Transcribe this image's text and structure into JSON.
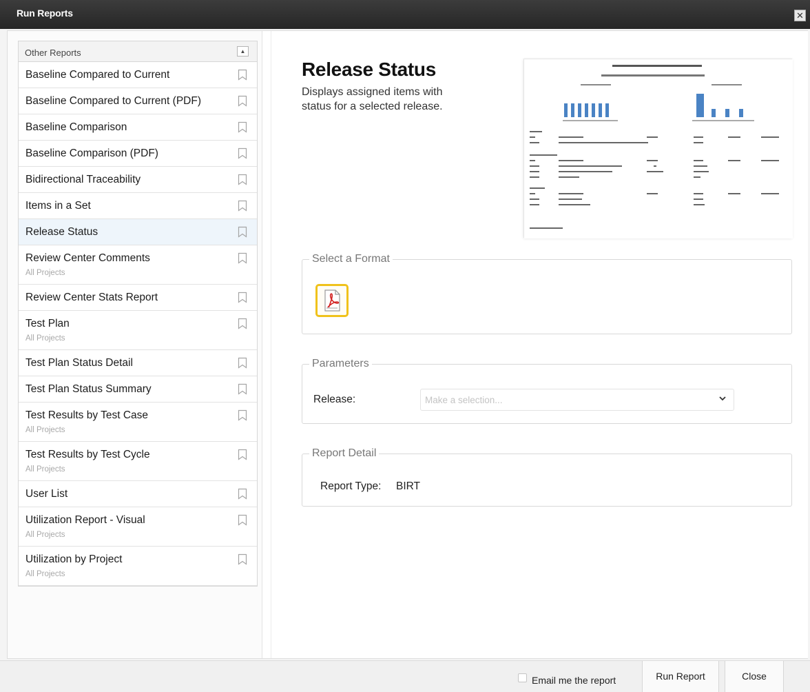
{
  "window": {
    "title": "Run Reports",
    "close_icon": "✕"
  },
  "list": {
    "header": "Other Reports",
    "collapse_icon": "▲",
    "items": [
      {
        "name": "Baseline Compared to Current",
        "sub": ""
      },
      {
        "name": "Baseline Compared to Current (PDF)",
        "sub": ""
      },
      {
        "name": "Baseline Comparison",
        "sub": ""
      },
      {
        "name": "Baseline Comparison (PDF)",
        "sub": ""
      },
      {
        "name": "Bidirectional Traceability",
        "sub": ""
      },
      {
        "name": "Items in a Set",
        "sub": ""
      },
      {
        "name": "Release Status",
        "sub": "",
        "selected": true
      },
      {
        "name": "Review Center Comments",
        "sub": "All Projects"
      },
      {
        "name": "Review Center Stats Report",
        "sub": ""
      },
      {
        "name": "Test Plan",
        "sub": "All Projects"
      },
      {
        "name": "Test Plan Status Detail",
        "sub": ""
      },
      {
        "name": "Test Plan Status Summary",
        "sub": ""
      },
      {
        "name": "Test Results by Test Case",
        "sub": "All Projects"
      },
      {
        "name": "Test Results by Test Cycle",
        "sub": "All Projects"
      },
      {
        "name": "User List",
        "sub": ""
      },
      {
        "name": "Utilization Report - Visual",
        "sub": "All Projects"
      },
      {
        "name": "Utilization by Project",
        "sub": "All Projects"
      }
    ]
  },
  "detail": {
    "title": "Release Status",
    "description": "Displays assigned items with status for a selected release.",
    "format_legend": "Select a Format",
    "parameters_legend": "Parameters",
    "release_label": "Release:",
    "release_placeholder": "Make a selection...",
    "report_detail_legend": "Report Detail",
    "report_type_label": "Report Type:",
    "report_type_value": "BIRT"
  },
  "footer": {
    "email_label": "Email me the report",
    "email_checked": false,
    "run_label": "Run Report",
    "close_label": "Close"
  },
  "colors": {
    "format_highlight": "#f0c21b",
    "selected_row": "#eef5fb",
    "titlebar": "#2e2e2e"
  }
}
